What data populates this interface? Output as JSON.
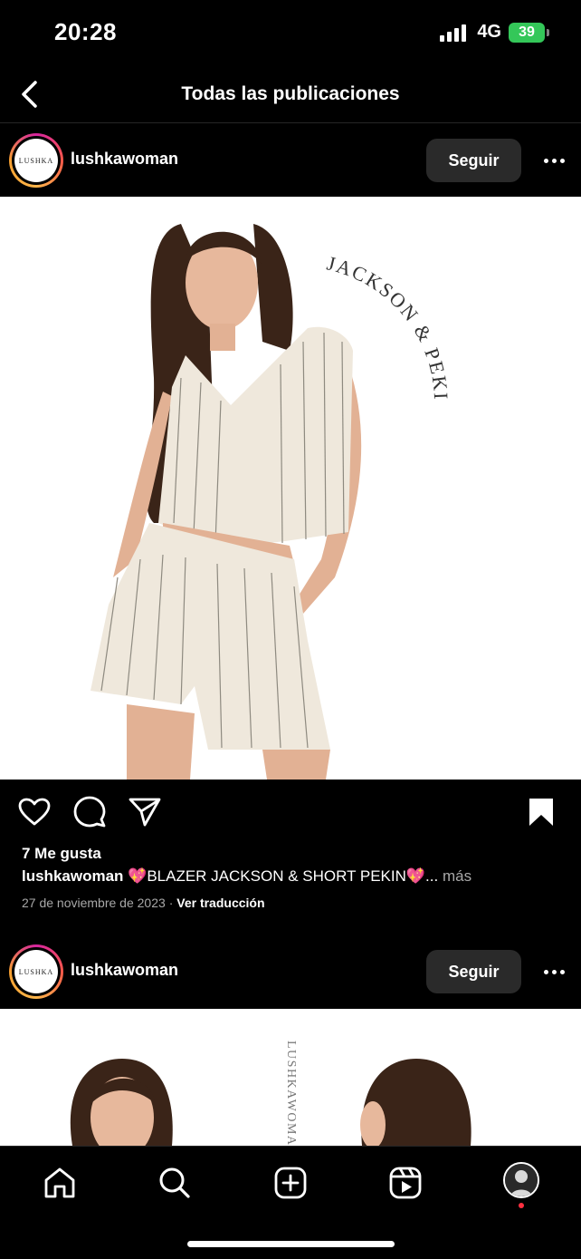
{
  "status_bar": {
    "time": "20:28",
    "network": "4G",
    "battery": "39"
  },
  "header": {
    "title": "Todas las publicaciones"
  },
  "posts": [
    {
      "username": "lushkawoman",
      "avatar_text": "LUSHKA",
      "follow_label": "Seguir",
      "image_text": "JACKSON & PEKIN",
      "likes": "7 Me gusta",
      "caption_user": "lushkawoman",
      "caption_text": "💖BLAZER JACKSON & SHORT PEKIN💖...",
      "caption_more": "más",
      "date": "27 de noviembre de 2023",
      "translate_label": "Ver traducción"
    },
    {
      "username": "lushkawoman",
      "avatar_text": "LUSHKA",
      "follow_label": "Seguir",
      "image_text": "LUSHKAWOMAN"
    }
  ],
  "icons": {
    "back": "chevron-left-icon",
    "more": "more-horizontal-icon",
    "like": "heart-icon",
    "comment": "comment-icon",
    "share": "send-icon",
    "save": "bookmark-icon",
    "home": "home-icon",
    "search": "search-icon",
    "create": "plus-square-icon",
    "reels": "reels-icon"
  },
  "colors": {
    "background": "#000000",
    "follow_button": "#2a2a2a",
    "battery": "#34c759",
    "notification_dot": "#ff3040",
    "secondary_text": "#a8a8a8"
  }
}
